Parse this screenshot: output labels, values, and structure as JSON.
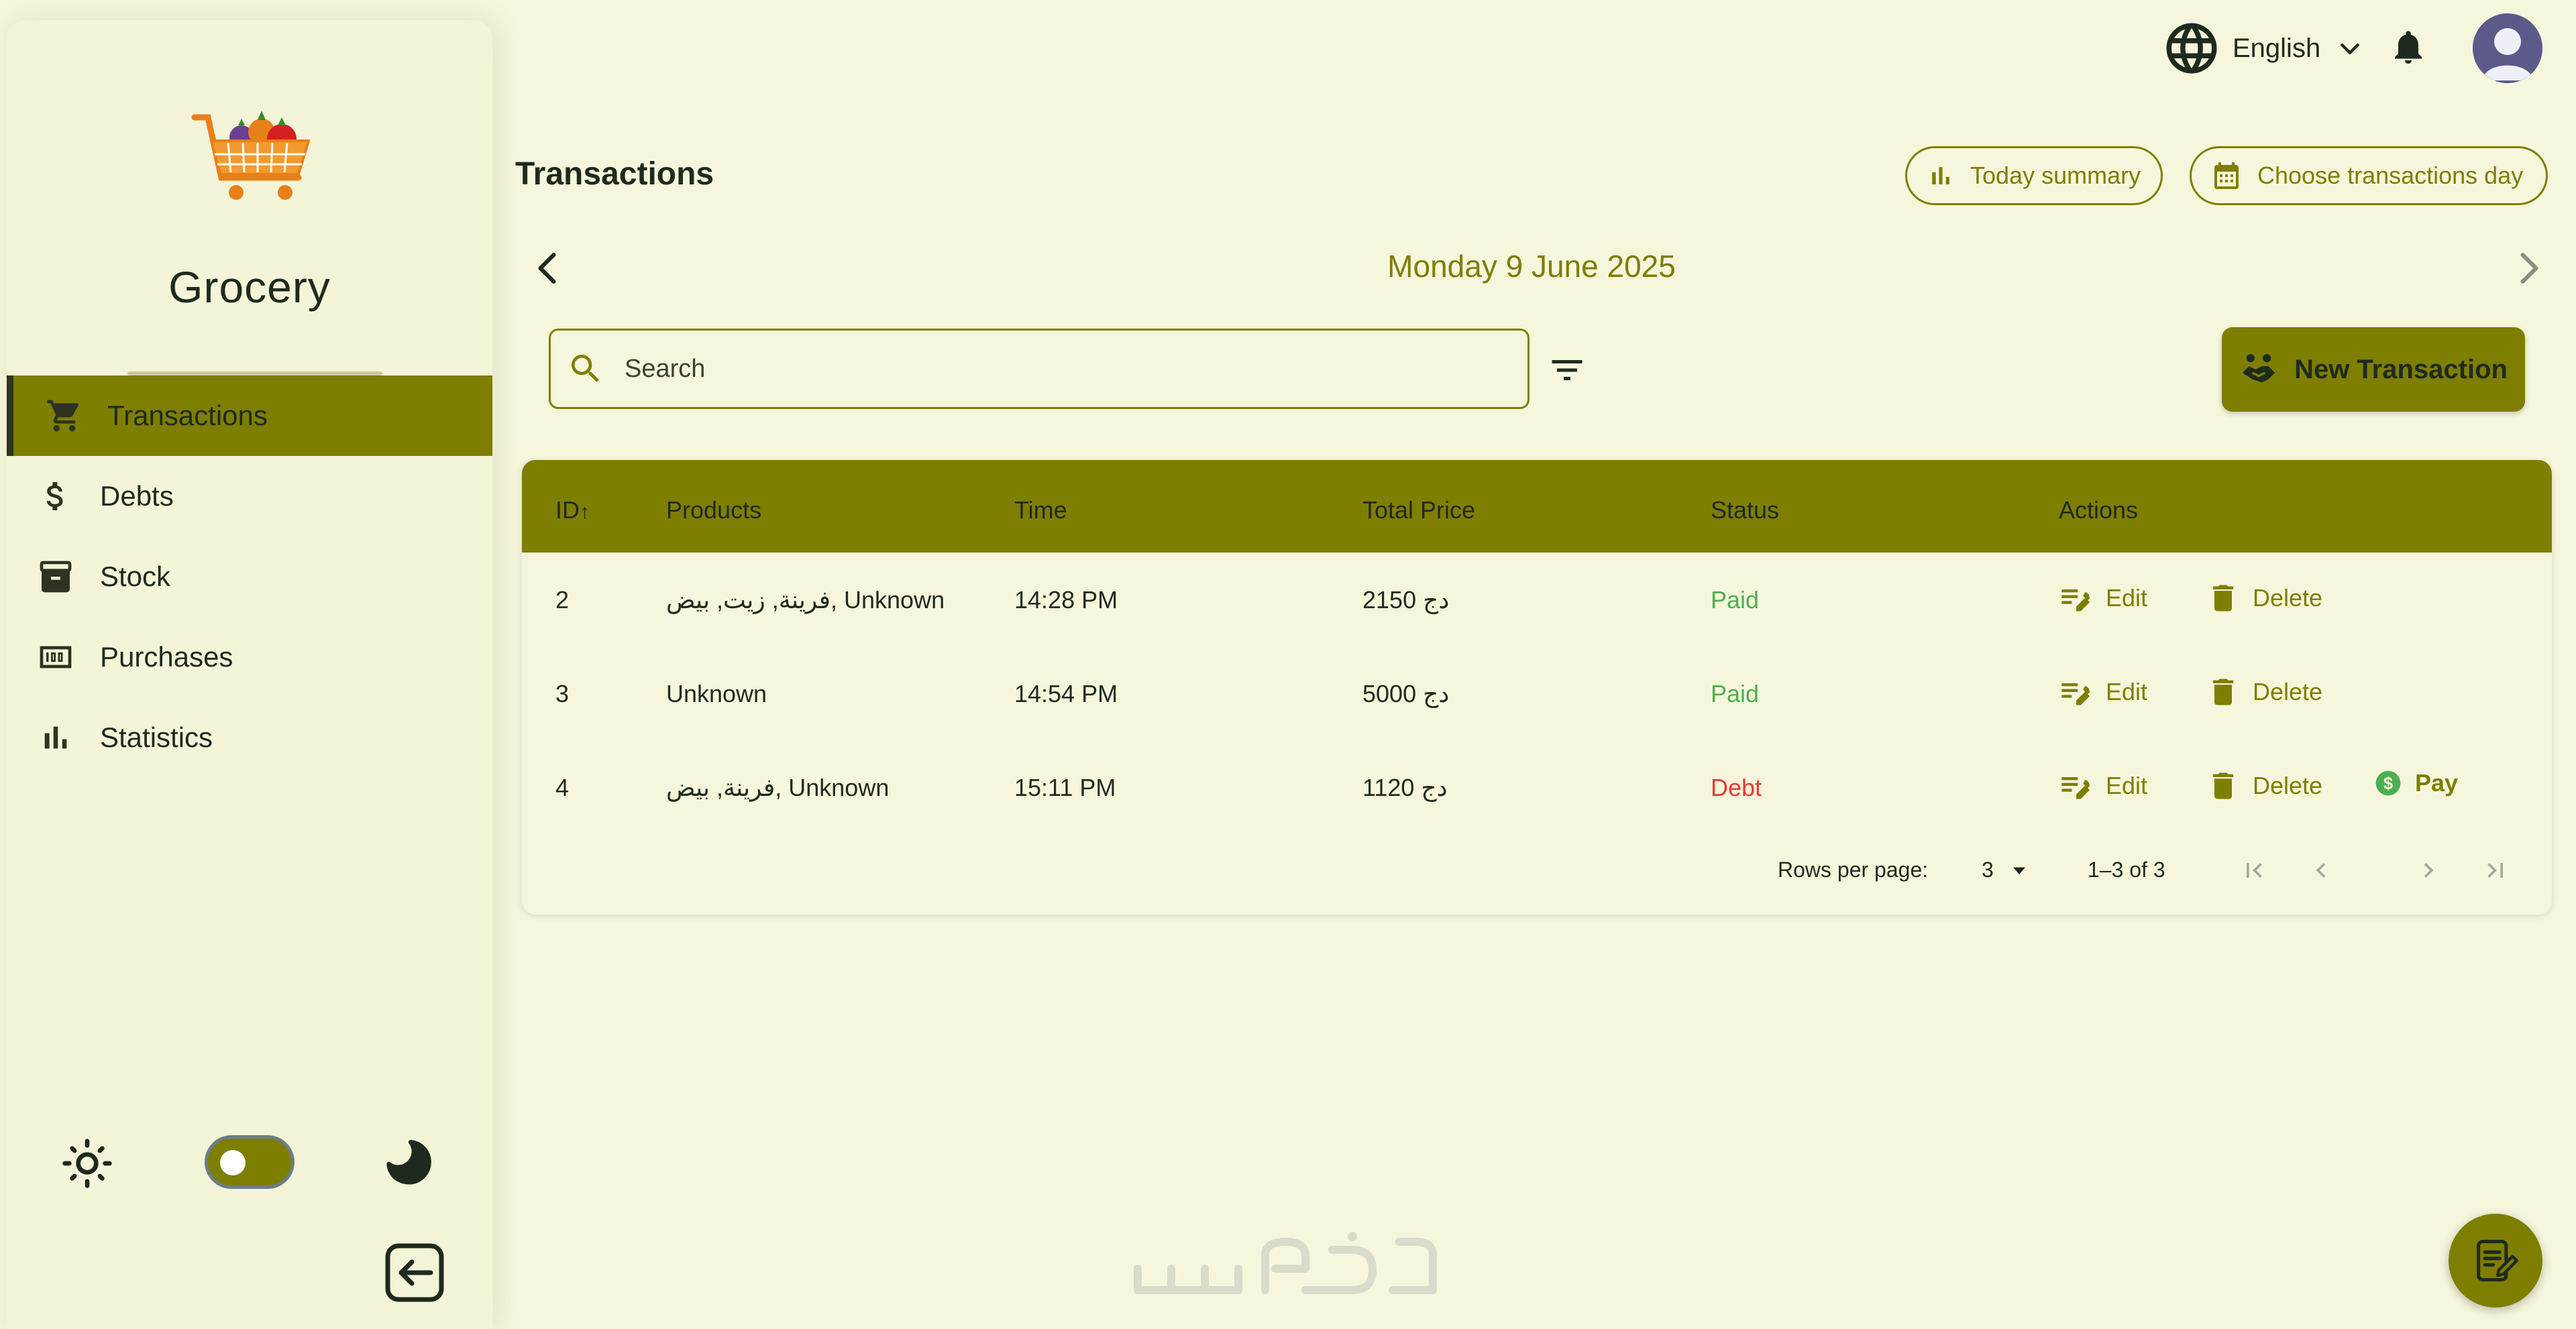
{
  "app": {
    "brand": "Grocery"
  },
  "colors": {
    "accent": "#7e7e00",
    "background": "#f6f6dc",
    "paid": "#4caf50",
    "debt": "#e53935"
  },
  "sidebar": {
    "items": [
      {
        "label": "Transactions",
        "icon": "cart-icon",
        "active": true
      },
      {
        "label": "Debts",
        "icon": "dollar-icon"
      },
      {
        "label": "Stock",
        "icon": "archive-icon"
      },
      {
        "label": "Purchases",
        "icon": "hundred-icon"
      },
      {
        "label": "Statistics",
        "icon": "bar-chart-icon"
      }
    ],
    "theme_toggle": {
      "state": "light"
    }
  },
  "topbar": {
    "language": "English"
  },
  "page": {
    "title": "Transactions",
    "today_summary_label": "Today summary",
    "choose_day_label": "Choose transactions day",
    "date": "Monday 9 June 2025"
  },
  "toolbar": {
    "search_placeholder": "Search",
    "new_transaction_label": "New Transaction"
  },
  "table": {
    "headers": {
      "id": "ID",
      "products": "Products",
      "time": "Time",
      "total_price": "Total Price",
      "status": "Status",
      "actions": "Actions"
    },
    "sort_indicator": "↑",
    "rows": [
      {
        "id": "2",
        "products": "فرينة, زيت, بيض, Unknown",
        "time": "14:28 PM",
        "price": "2150 دج",
        "status": "Paid",
        "actions": [
          "Edit",
          "Delete"
        ]
      },
      {
        "id": "3",
        "products": "Unknown",
        "time": "14:54 PM",
        "price": "5000 دج",
        "status": "Paid",
        "actions": [
          "Edit",
          "Delete"
        ]
      },
      {
        "id": "4",
        "products": "فرينة, بيض, Unknown",
        "time": "15:11 PM",
        "price": "1120 دج",
        "status": "Debt",
        "actions": [
          "Edit",
          "Delete",
          "Pay"
        ]
      }
    ],
    "pagination": {
      "rows_per_page_label": "Rows per page:",
      "rows_per_page": "3",
      "range": "1–3 of 3"
    }
  }
}
